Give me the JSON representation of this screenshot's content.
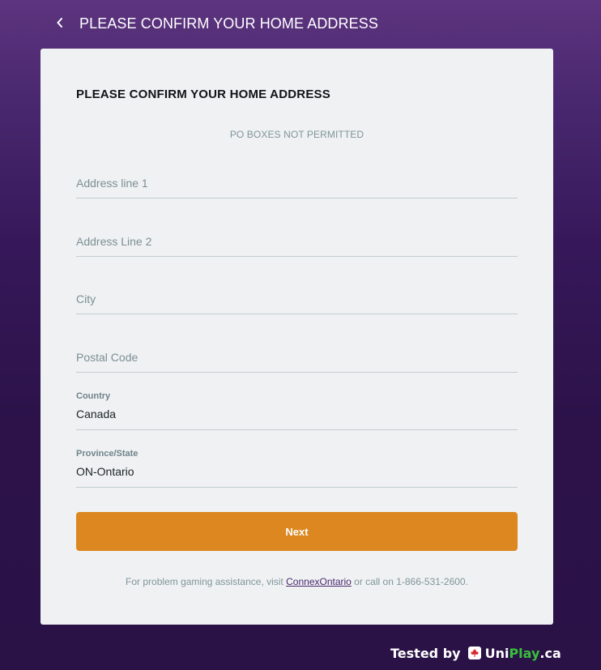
{
  "header": {
    "title": "PLEASE CONFIRM YOUR HOME ADDRESS"
  },
  "form": {
    "title": "PLEASE CONFIRM YOUR HOME ADDRESS",
    "notice": "PO BOXES NOT PERMITTED",
    "fields": {
      "address_line_1": {
        "placeholder": "Address line 1",
        "value": ""
      },
      "address_line_2": {
        "placeholder": "Address Line 2",
        "value": ""
      },
      "city": {
        "placeholder": "City",
        "value": ""
      },
      "postal_code": {
        "placeholder": "Postal Code",
        "value": ""
      }
    },
    "country": {
      "label": "Country",
      "value": "Canada"
    },
    "province": {
      "label": "Province/State",
      "value": "ON-Ontario"
    },
    "next_label": "Next"
  },
  "help": {
    "prefix": "For problem gaming assistance, visit ",
    "link_text": "ConnexOntario",
    "suffix": " or call on 1-866-531-2600."
  },
  "watermark": {
    "tested_by": "Tested by",
    "brand_uni": "Uni",
    "brand_play": "Play",
    "brand_ca": ".ca"
  },
  "colors": {
    "accent_button": "#dc871f",
    "background_purple": "#36185a",
    "card": "#eff1f2"
  },
  "icons": {
    "back": "chevron-left-icon",
    "watermark_logo": "maple-leaf-icon"
  }
}
